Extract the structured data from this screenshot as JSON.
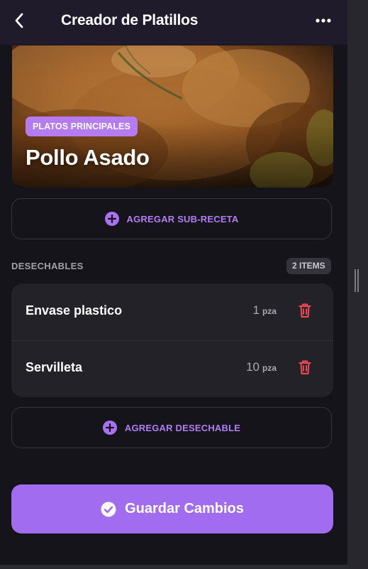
{
  "header": {
    "title": "Creador de Platillos",
    "back_icon": "chevron-left-icon",
    "menu_icon": "more-horizontal-icon"
  },
  "hero": {
    "category": "PLATOS PRINCIPALES",
    "dish_name": "Pollo Asado"
  },
  "add_subrecipe": {
    "label": "AGREGAR SUB-RECETA",
    "icon": "plus-circle-icon"
  },
  "disposables": {
    "section_label": "DESECHABLES",
    "count": "2 ITEMS",
    "items": [
      {
        "name": "Envase plastico",
        "qty": "1",
        "unit": "pza"
      },
      {
        "name": "Servilleta",
        "qty": "10",
        "unit": "pza"
      }
    ],
    "delete_icon": "trash-icon"
  },
  "add_disposable": {
    "label": "AGREGAR DESECHABLE",
    "icon": "plus-circle-icon"
  },
  "save": {
    "label": "Guardar Cambios",
    "icon": "check-circle-icon"
  },
  "colors": {
    "accent": "#a26cf0",
    "accent_light": "#b07ef2",
    "danger": "#e5484d",
    "background": "#15141b",
    "card": "#232228"
  }
}
